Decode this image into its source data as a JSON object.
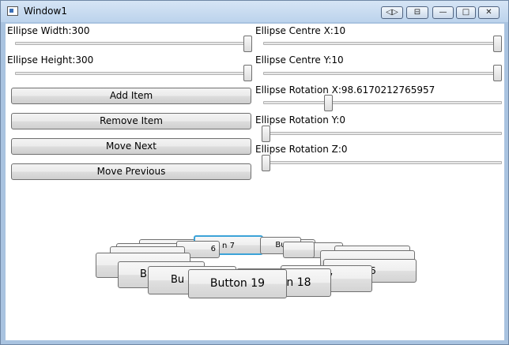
{
  "window": {
    "title": "Window1",
    "caption_buttons": [
      "◁▷",
      "⊟",
      "—",
      "□",
      "✕"
    ]
  },
  "sliders": {
    "ellipse_width": {
      "label": "Ellipse Width:300",
      "value_fraction": 1.0
    },
    "ellipse_height": {
      "label": "Ellipse Height:300",
      "value_fraction": 1.0
    },
    "ellipse_centre_x": {
      "label": "Ellipse Centre X:10",
      "value_fraction": 1.0
    },
    "ellipse_centre_y": {
      "label": "Ellipse Centre Y:10",
      "value_fraction": 1.0
    },
    "ellipse_rotation_x": {
      "label": "Ellipse Rotation X:98.6170212765957",
      "value_fraction": 0.27
    },
    "ellipse_rotation_y": {
      "label": "Ellipse Rotation Y:0",
      "value_fraction": 0.0
    },
    "ellipse_rotation_z": {
      "label": "Ellipse Rotation Z:0",
      "value_fraction": 0.0
    }
  },
  "buttons": {
    "add_item": "Add Item",
    "remove_item": "Remove Item",
    "move_next": "Move Next",
    "move_previous": "Move Previous"
  },
  "carousel": {
    "back_0": "6",
    "back_1": "n 7",
    "back_2": "Bu",
    "back_3": "B",
    "back_4": "Bu",
    "item_18": "Button 18",
    "item_17": "17",
    "item_16": "16",
    "item_19": "Button 19"
  }
}
